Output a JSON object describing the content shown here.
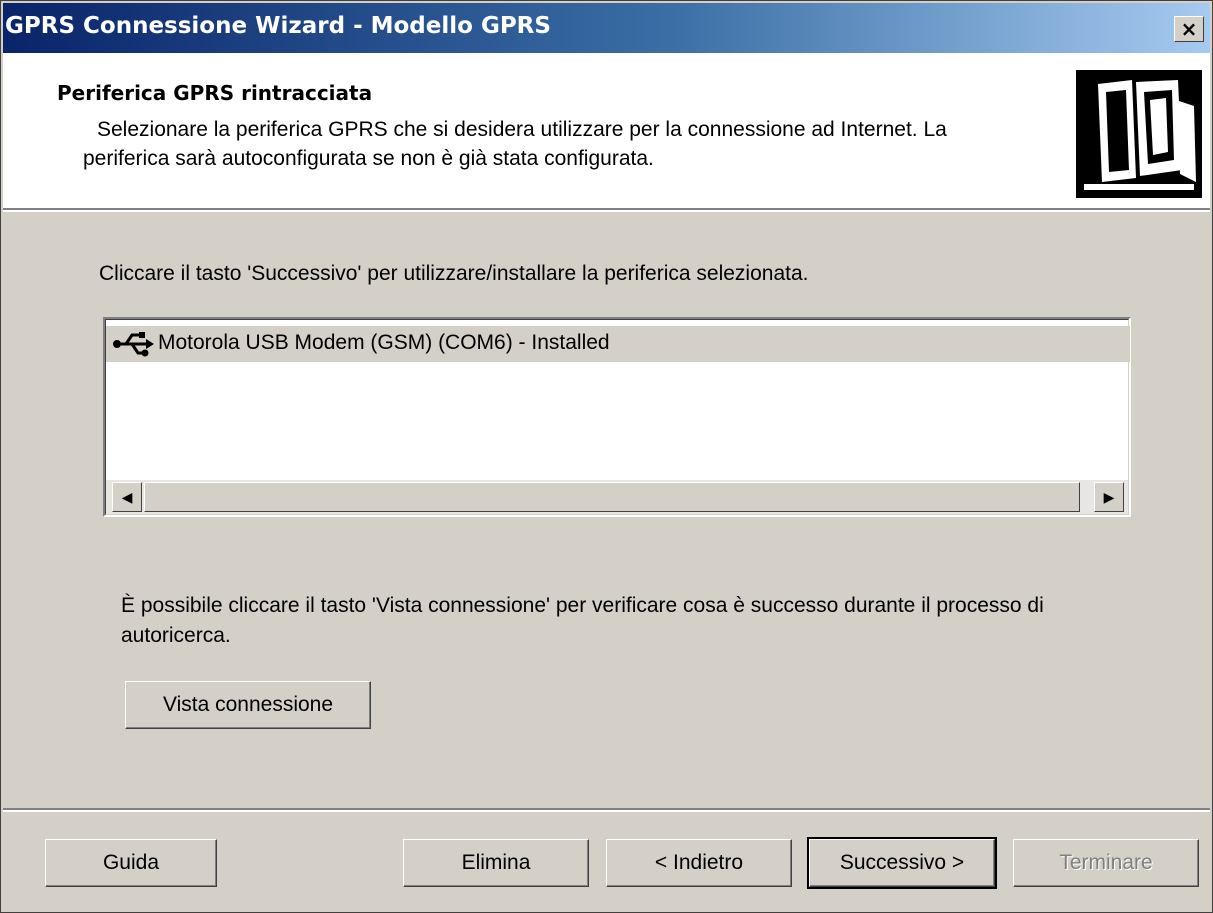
{
  "window": {
    "title": "GPRS Connessione Wizard - Modello GPRS",
    "close_label": "×"
  },
  "header": {
    "title": "Periferica GPRS rintracciata",
    "subtitle": "Selezionare la periferica GPRS che si desidera utilizzare per la connessione ad Internet.  La periferica sarà autoconfigurata se non è già stata configurata.",
    "icon": "computer-icon"
  },
  "instruction": "Cliccare il tasto 'Successivo' per utilizzare/installare la periferica selezionata.",
  "device_list": {
    "items": [
      {
        "label": "Motorola USB Modem (GSM) (COM6) - Installed",
        "icon": "usb-icon",
        "selected": true
      }
    ],
    "scroll_left": "◀",
    "scroll_right": "▶"
  },
  "note": "È possibile cliccare il tasto 'Vista connessione' per verificare cosa è successo durante il processo di autoricerca.",
  "view_connection_button": "Vista connessione",
  "footer": {
    "help": "Guida",
    "delete": "Elimina",
    "back": "< Indietro",
    "next": "Successivo >",
    "finish": "Terminare"
  },
  "colors": {
    "title_gradient_start": "#0a246a",
    "title_gradient_end": "#a6caf0",
    "dialog_face": "#d4d0c8",
    "header_bg": "#ffffff"
  }
}
